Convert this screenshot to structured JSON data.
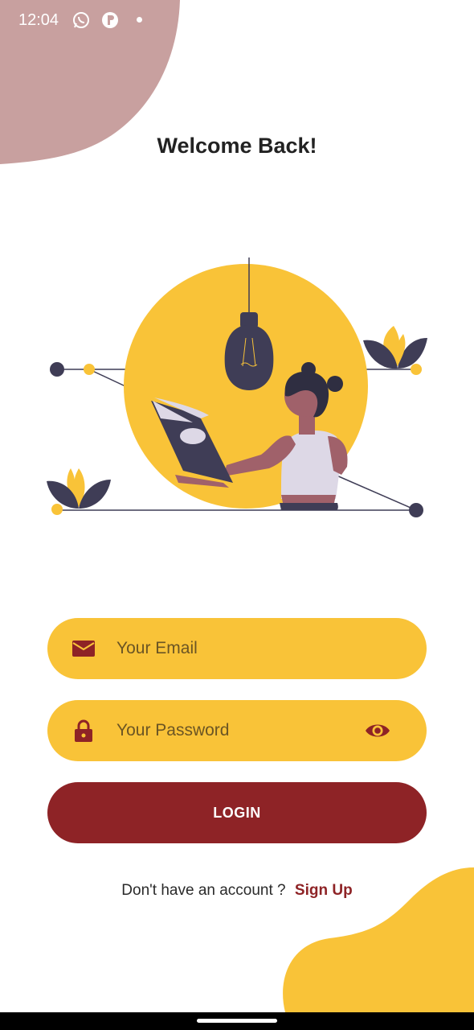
{
  "status_bar": {
    "time": "12:04",
    "icons": [
      "whatsapp-icon",
      "app-notification-icon",
      "dot-indicator"
    ]
  },
  "page": {
    "title": "Welcome Back!"
  },
  "form": {
    "email": {
      "placeholder": "Your Email",
      "value": "",
      "icon": "mail-icon"
    },
    "password": {
      "placeholder": "Your Password",
      "value": "",
      "icon": "lock-icon",
      "toggle_icon": "eye-icon"
    },
    "login_label": "LOGIN"
  },
  "signup": {
    "prompt": "Don't have an account ?",
    "link": "Sign Up"
  },
  "colors": {
    "accent_yellow": "#f9c338",
    "brand_red": "#8e2326",
    "blob_top": "#c8a09f",
    "dark_navy": "#3f3d56"
  }
}
